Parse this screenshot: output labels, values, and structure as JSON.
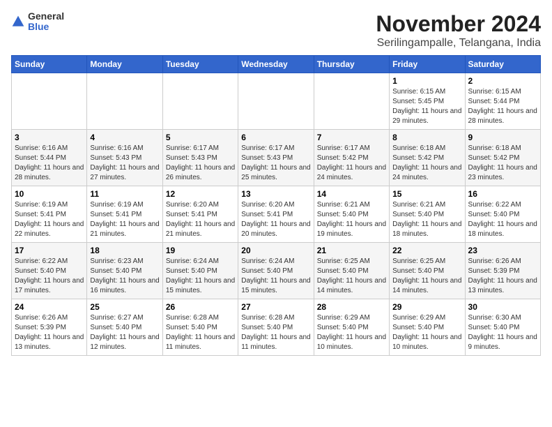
{
  "header": {
    "logo": {
      "general": "General",
      "blue": "Blue"
    },
    "title": "November 2024",
    "subtitle": "Serilingampalle, Telangana, India"
  },
  "days_of_week": [
    "Sunday",
    "Monday",
    "Tuesday",
    "Wednesday",
    "Thursday",
    "Friday",
    "Saturday"
  ],
  "weeks": [
    [
      {
        "day": "",
        "info": ""
      },
      {
        "day": "",
        "info": ""
      },
      {
        "day": "",
        "info": ""
      },
      {
        "day": "",
        "info": ""
      },
      {
        "day": "",
        "info": ""
      },
      {
        "day": "1",
        "info": "Sunrise: 6:15 AM\nSunset: 5:45 PM\nDaylight: 11 hours and 29 minutes."
      },
      {
        "day": "2",
        "info": "Sunrise: 6:15 AM\nSunset: 5:44 PM\nDaylight: 11 hours and 28 minutes."
      }
    ],
    [
      {
        "day": "3",
        "info": "Sunrise: 6:16 AM\nSunset: 5:44 PM\nDaylight: 11 hours and 28 minutes."
      },
      {
        "day": "4",
        "info": "Sunrise: 6:16 AM\nSunset: 5:43 PM\nDaylight: 11 hours and 27 minutes."
      },
      {
        "day": "5",
        "info": "Sunrise: 6:17 AM\nSunset: 5:43 PM\nDaylight: 11 hours and 26 minutes."
      },
      {
        "day": "6",
        "info": "Sunrise: 6:17 AM\nSunset: 5:43 PM\nDaylight: 11 hours and 25 minutes."
      },
      {
        "day": "7",
        "info": "Sunrise: 6:17 AM\nSunset: 5:42 PM\nDaylight: 11 hours and 24 minutes."
      },
      {
        "day": "8",
        "info": "Sunrise: 6:18 AM\nSunset: 5:42 PM\nDaylight: 11 hours and 24 minutes."
      },
      {
        "day": "9",
        "info": "Sunrise: 6:18 AM\nSunset: 5:42 PM\nDaylight: 11 hours and 23 minutes."
      }
    ],
    [
      {
        "day": "10",
        "info": "Sunrise: 6:19 AM\nSunset: 5:41 PM\nDaylight: 11 hours and 22 minutes."
      },
      {
        "day": "11",
        "info": "Sunrise: 6:19 AM\nSunset: 5:41 PM\nDaylight: 11 hours and 21 minutes."
      },
      {
        "day": "12",
        "info": "Sunrise: 6:20 AM\nSunset: 5:41 PM\nDaylight: 11 hours and 21 minutes."
      },
      {
        "day": "13",
        "info": "Sunrise: 6:20 AM\nSunset: 5:41 PM\nDaylight: 11 hours and 20 minutes."
      },
      {
        "day": "14",
        "info": "Sunrise: 6:21 AM\nSunset: 5:40 PM\nDaylight: 11 hours and 19 minutes."
      },
      {
        "day": "15",
        "info": "Sunrise: 6:21 AM\nSunset: 5:40 PM\nDaylight: 11 hours and 18 minutes."
      },
      {
        "day": "16",
        "info": "Sunrise: 6:22 AM\nSunset: 5:40 PM\nDaylight: 11 hours and 18 minutes."
      }
    ],
    [
      {
        "day": "17",
        "info": "Sunrise: 6:22 AM\nSunset: 5:40 PM\nDaylight: 11 hours and 17 minutes."
      },
      {
        "day": "18",
        "info": "Sunrise: 6:23 AM\nSunset: 5:40 PM\nDaylight: 11 hours and 16 minutes."
      },
      {
        "day": "19",
        "info": "Sunrise: 6:24 AM\nSunset: 5:40 PM\nDaylight: 11 hours and 15 minutes."
      },
      {
        "day": "20",
        "info": "Sunrise: 6:24 AM\nSunset: 5:40 PM\nDaylight: 11 hours and 15 minutes."
      },
      {
        "day": "21",
        "info": "Sunrise: 6:25 AM\nSunset: 5:40 PM\nDaylight: 11 hours and 14 minutes."
      },
      {
        "day": "22",
        "info": "Sunrise: 6:25 AM\nSunset: 5:40 PM\nDaylight: 11 hours and 14 minutes."
      },
      {
        "day": "23",
        "info": "Sunrise: 6:26 AM\nSunset: 5:39 PM\nDaylight: 11 hours and 13 minutes."
      }
    ],
    [
      {
        "day": "24",
        "info": "Sunrise: 6:26 AM\nSunset: 5:39 PM\nDaylight: 11 hours and 13 minutes."
      },
      {
        "day": "25",
        "info": "Sunrise: 6:27 AM\nSunset: 5:40 PM\nDaylight: 11 hours and 12 minutes."
      },
      {
        "day": "26",
        "info": "Sunrise: 6:28 AM\nSunset: 5:40 PM\nDaylight: 11 hours and 11 minutes."
      },
      {
        "day": "27",
        "info": "Sunrise: 6:28 AM\nSunset: 5:40 PM\nDaylight: 11 hours and 11 minutes."
      },
      {
        "day": "28",
        "info": "Sunrise: 6:29 AM\nSunset: 5:40 PM\nDaylight: 11 hours and 10 minutes."
      },
      {
        "day": "29",
        "info": "Sunrise: 6:29 AM\nSunset: 5:40 PM\nDaylight: 11 hours and 10 minutes."
      },
      {
        "day": "30",
        "info": "Sunrise: 6:30 AM\nSunset: 5:40 PM\nDaylight: 11 hours and 9 minutes."
      }
    ]
  ]
}
